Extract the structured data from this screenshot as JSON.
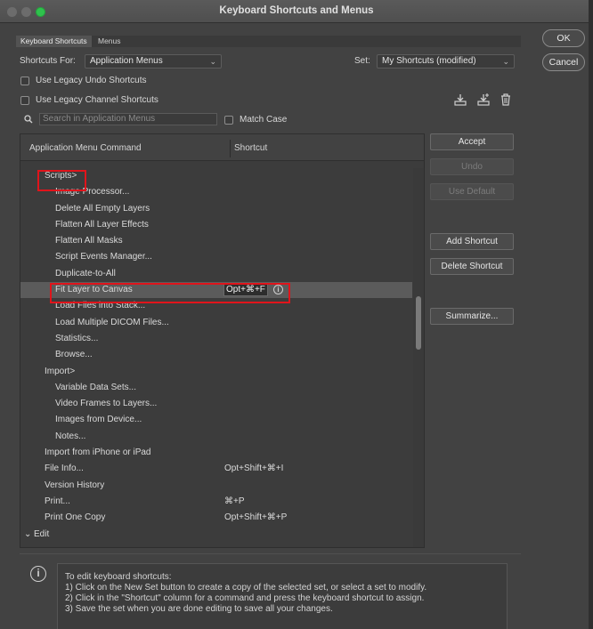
{
  "window": {
    "title": "Keyboard Shortcuts and Menus"
  },
  "tabs": [
    {
      "label": "Keyboard Shortcuts",
      "active": true
    },
    {
      "label": "Menus",
      "active": false
    }
  ],
  "dialog_buttons": {
    "ok": "OK",
    "cancel": "Cancel"
  },
  "shortcuts_for": {
    "label": "Shortcuts For:",
    "value": "Application Menus"
  },
  "set": {
    "label": "Set:",
    "value": "My Shortcuts (modified)"
  },
  "options": {
    "legacy_undo": "Use Legacy Undo Shortcuts",
    "legacy_channel": "Use Legacy Channel Shortcuts",
    "match_case": "Match Case"
  },
  "search": {
    "placeholder": "Search in Application Menus"
  },
  "table": {
    "col_command": "Application Menu Command",
    "col_shortcut": "Shortcut",
    "rows": [
      {
        "command": "Scripts>",
        "shortcut": "",
        "indent": 1
      },
      {
        "command": "Image Processor...",
        "shortcut": "",
        "indent": 2
      },
      {
        "command": "Delete All Empty Layers",
        "shortcut": "",
        "indent": 2
      },
      {
        "command": "Flatten All Layer Effects",
        "shortcut": "",
        "indent": 2
      },
      {
        "command": "Flatten All Masks",
        "shortcut": "",
        "indent": 2
      },
      {
        "command": "Script Events Manager...",
        "shortcut": "",
        "indent": 2
      },
      {
        "command": "Duplicate-to-All",
        "shortcut": "",
        "indent": 2
      },
      {
        "command": "Fit Layer to Canvas",
        "shortcut": "Opt+⌘+F",
        "indent": 2,
        "selected": true
      },
      {
        "command": "Load Files into Stack...",
        "shortcut": "",
        "indent": 2
      },
      {
        "command": "Load Multiple DICOM Files...",
        "shortcut": "",
        "indent": 2
      },
      {
        "command": "Statistics...",
        "shortcut": "",
        "indent": 2
      },
      {
        "command": "Browse...",
        "shortcut": "",
        "indent": 2
      },
      {
        "command": "Import>",
        "shortcut": "",
        "indent": 1
      },
      {
        "command": "Variable Data Sets...",
        "shortcut": "",
        "indent": 2
      },
      {
        "command": "Video Frames to Layers...",
        "shortcut": "",
        "indent": 2
      },
      {
        "command": "Images from Device...",
        "shortcut": "",
        "indent": 2
      },
      {
        "command": "Notes...",
        "shortcut": "",
        "indent": 2
      },
      {
        "command": "Import from iPhone or iPad",
        "shortcut": "",
        "indent": 1
      },
      {
        "command": "File Info...",
        "shortcut": "Opt+Shift+⌘+I",
        "indent": 1
      },
      {
        "command": "Version History",
        "shortcut": "",
        "indent": 1
      },
      {
        "command": "Print...",
        "shortcut": "⌘+P",
        "indent": 1
      },
      {
        "command": "Print One Copy",
        "shortcut": "Opt+Shift+⌘+P",
        "indent": 1
      },
      {
        "command": "Edit",
        "shortcut": "",
        "indent": 0,
        "group": true
      }
    ]
  },
  "side_buttons": {
    "accept": "Accept",
    "undo": "Undo",
    "use_default": "Use Default",
    "add_shortcut": "Add Shortcut",
    "delete_shortcut": "Delete Shortcut",
    "summarize": "Summarize..."
  },
  "info": {
    "lines": [
      "To edit keyboard shortcuts:",
      "1) Click on the New Set button to create a copy of the selected set, or select a set to modify.",
      "2) Click in the \"Shortcut\" column for a command and press the keyboard shortcut to assign.",
      "3) Save the set when you are done editing to save all your changes."
    ]
  },
  "icons": [
    "search-icon",
    "save-set-icon",
    "new-set-icon",
    "delete-set-icon",
    "info-icon",
    "chevron-down-icon"
  ],
  "colors": {
    "highlight": "#e0141b",
    "selected_row": "#5b5b5b",
    "window_bg": "#424242"
  }
}
